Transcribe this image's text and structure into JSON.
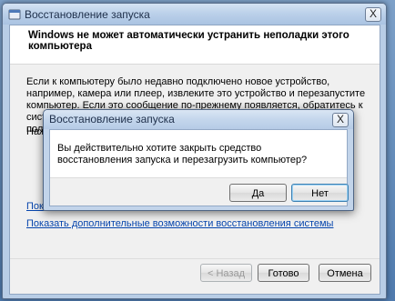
{
  "main_window": {
    "title": "Восстановление запуска",
    "close_label": "X",
    "header": "Windows не может автоматически устранить неполадки этого компьютера",
    "body": "Если к компьютеру было недавно подключено новое устройство, например, камера или плеер, извлеките это устройство и перезапустите компьютер. Если это сообщение по-прежнему появляется, обратитесь к системному администратору или изготовителю компьютера для получения помощи.",
    "partial_text": "Наж",
    "link_partial": "Показ",
    "link_options": "Показать дополнительные возможности восстановления системы",
    "buttons": {
      "back": "< Назад",
      "finish": "Готово",
      "cancel": "Отмена"
    }
  },
  "dialog": {
    "title": "Восстановление запуска",
    "close_label": "X",
    "message": "Вы действительно хотите закрыть средство восстановления запуска и перезагрузить компьютер?",
    "buttons": {
      "yes": "Да",
      "no": "Нет"
    }
  },
  "icons": {
    "title_icon": "windows-app-icon",
    "close_icon": "close-icon"
  },
  "colors": {
    "titlebar": "#bcd1ea",
    "link": "#0645ad",
    "desktop": "#5f84b0"
  }
}
